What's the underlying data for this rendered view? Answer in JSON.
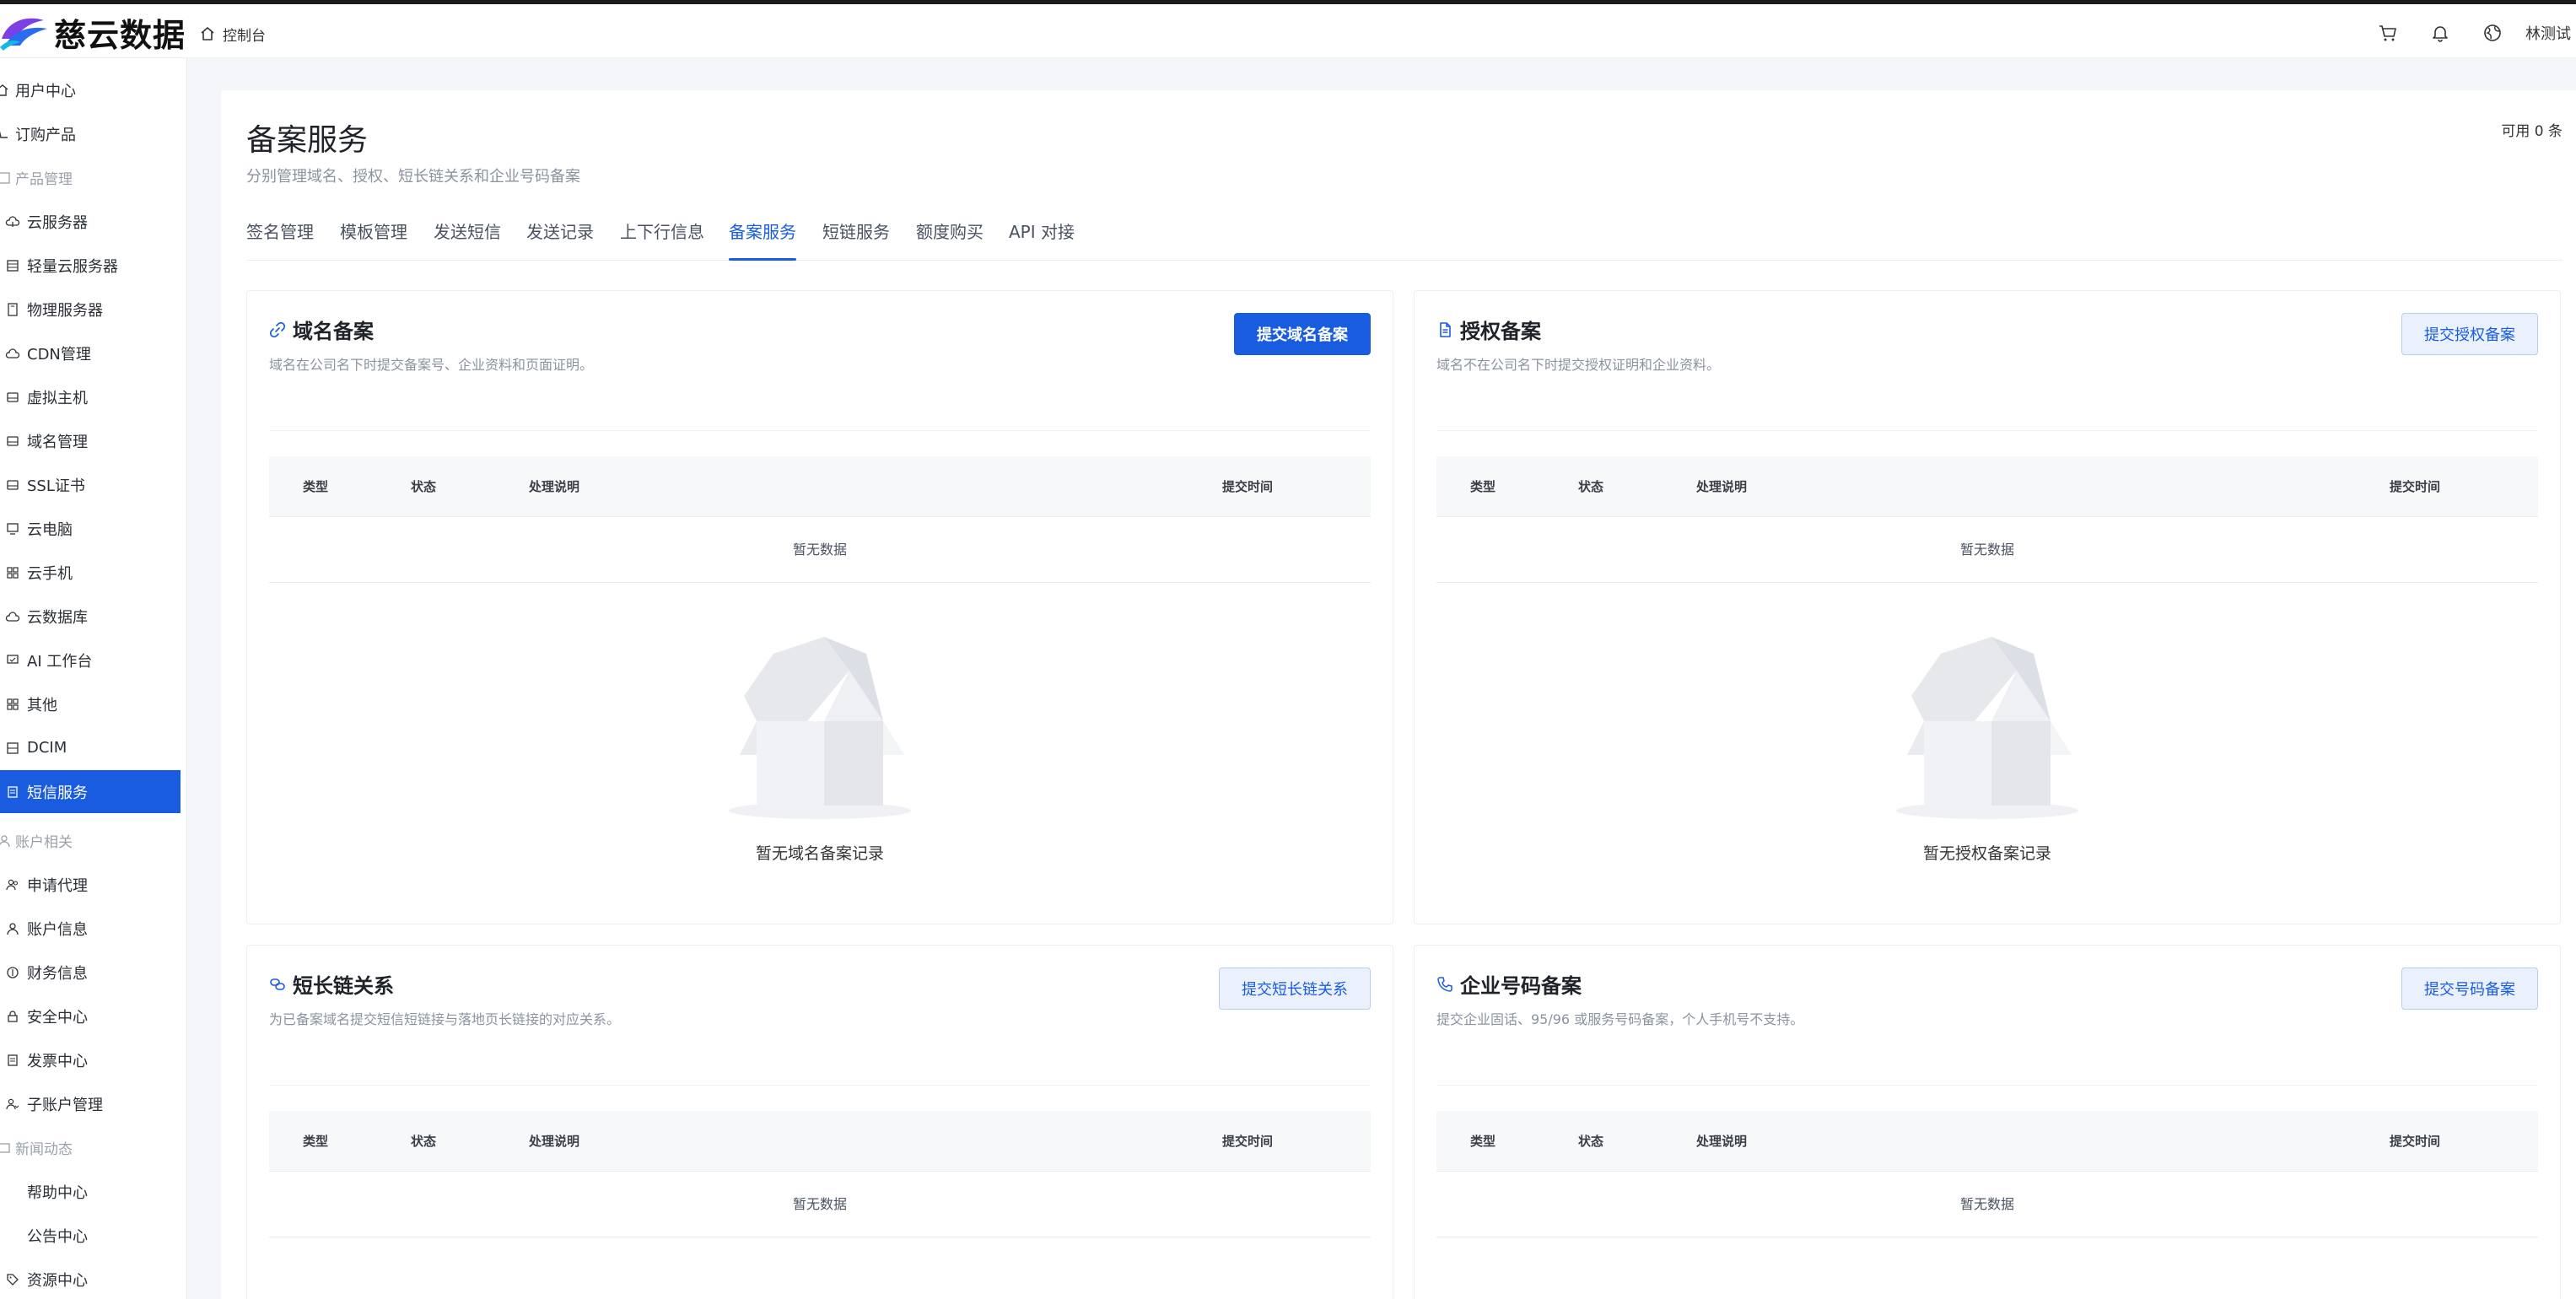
{
  "brand": {
    "name": "慈云数据"
  },
  "header": {
    "console_label": "控制台",
    "user_name": "林测试",
    "icons": [
      "cart-icon",
      "bell-icon",
      "globe-icon"
    ]
  },
  "sidebar": {
    "items": [
      {
        "label": "用户中心",
        "icon": "home-icon",
        "kind": "top"
      },
      {
        "label": "订购产品",
        "icon": "cart-icon",
        "kind": "top"
      },
      {
        "label": "产品管理",
        "icon": "grid-icon",
        "kind": "group"
      },
      {
        "label": "云服务器",
        "icon": "cloud-icon"
      },
      {
        "label": "轻量云服务器",
        "icon": "server-icon"
      },
      {
        "label": "物理服务器",
        "icon": "box-icon"
      },
      {
        "label": "CDN管理",
        "icon": "cloud-icon"
      },
      {
        "label": "虚拟主机",
        "icon": "drive-icon"
      },
      {
        "label": "域名管理",
        "icon": "drive-icon"
      },
      {
        "label": "SSL证书",
        "icon": "drive-icon"
      },
      {
        "label": "云电脑",
        "icon": "monitor-icon"
      },
      {
        "label": "云手机",
        "icon": "apps-icon"
      },
      {
        "label": "云数据库",
        "icon": "cloud-icon"
      },
      {
        "label": "AI 工作台",
        "icon": "monitor-icon"
      },
      {
        "label": "其他",
        "icon": "apps-icon"
      },
      {
        "label": "DCIM",
        "icon": "server-icon"
      },
      {
        "label": "短信服务",
        "icon": "doc-icon",
        "active": true
      },
      {
        "label": "账户相关",
        "icon": "users-icon",
        "kind": "group"
      },
      {
        "label": "申请代理",
        "icon": "users-icon"
      },
      {
        "label": "账户信息",
        "icon": "user-icon"
      },
      {
        "label": "财务信息",
        "icon": "coin-icon"
      },
      {
        "label": "安全中心",
        "icon": "lock-icon"
      },
      {
        "label": "发票中心",
        "icon": "doc-icon"
      },
      {
        "label": "子账户管理",
        "icon": "users-icon"
      },
      {
        "label": "新闻动态",
        "icon": "news-icon",
        "kind": "group"
      },
      {
        "label": "帮助中心",
        "icon": "",
        "kind": "noicon"
      },
      {
        "label": "公告中心",
        "icon": "",
        "kind": "noicon"
      },
      {
        "label": "资源中心",
        "icon": "tag-icon"
      }
    ]
  },
  "page": {
    "title": "备案服务",
    "subtitle": "分别管理域名、授权、短长链关系和企业号码备案",
    "quota": "可用 0 条"
  },
  "tabs": [
    {
      "label": "签名管理"
    },
    {
      "label": "模板管理"
    },
    {
      "label": "发送短信"
    },
    {
      "label": "发送记录"
    },
    {
      "label": "上下行信息"
    },
    {
      "label": "备案服务",
      "active": true
    },
    {
      "label": "短链服务"
    },
    {
      "label": "额度购买"
    },
    {
      "label": "API 对接"
    }
  ],
  "table_columns": [
    "类型",
    "状态",
    "处理说明",
    "提交时间"
  ],
  "no_data_text": "暂无数据",
  "cards": {
    "domain": {
      "title": "域名备案",
      "desc": "域名在公司名下时提交备案号、企业资料和页面证明。",
      "button": "提交域名备案",
      "empty": "暂无域名备案记录"
    },
    "auth": {
      "title": "授权备案",
      "desc": "域名不在公司名下时提交授权证明和企业资料。",
      "button": "提交授权备案",
      "empty": "暂无授权备案记录"
    },
    "link": {
      "title": "短长链关系",
      "desc": "为已备案域名提交短信短链接与落地页长链接的对应关系。",
      "button": "提交短长链关系"
    },
    "phone": {
      "title": "企业号码备案",
      "desc": "提交企业固话、95/96 或服务号码备案，个人手机号不支持。",
      "button": "提交号码备案"
    }
  },
  "colors": {
    "accent": "#1a5ce0",
    "sidebar_active_bg": "#1a5ce0",
    "secondary_btn_bg": "#eaf1fd",
    "muted_text": "#8a93a0"
  }
}
